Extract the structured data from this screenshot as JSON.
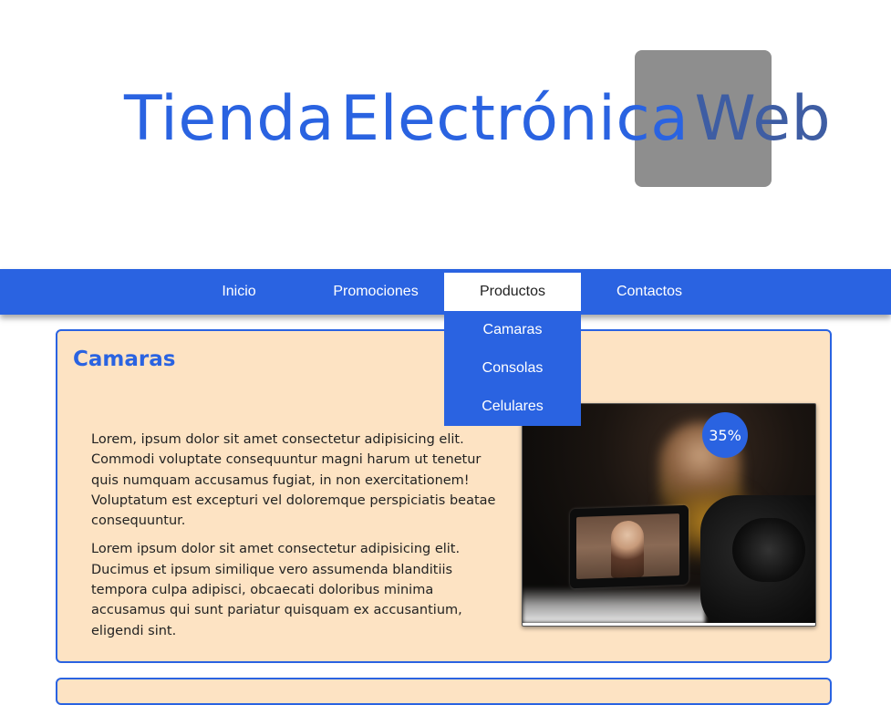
{
  "header": {
    "title_part1": "Tienda",
    "title_part2": "Electrónica",
    "title_part3": "Web"
  },
  "nav": {
    "items": [
      "Inicio",
      "Promociones",
      "Productos",
      "Contactos"
    ],
    "active": "Productos",
    "dropdown": [
      "Camaras",
      "Consolas",
      "Celulares"
    ]
  },
  "card": {
    "title": "Camaras",
    "paragraphs": [
      "Lorem, ipsum dolor sit amet consectetur adipisicing elit. Commodi voluptate consequuntur magni harum ut tenetur quis numquam accusamus fugiat, in non exercitationem! Voluptatum est excepturi vel doloremque perspiciatis beatae consequuntur.",
      "Lorem ipsum dolor sit amet consectetur adipisicing elit. Ducimus et ipsum similique vero assumenda blanditiis tempora culpa adipisci, obcaecati doloribus minima accusamus qui sunt pariatur quisquam ex accusantium, eligendi sint."
    ],
    "image_icon": "camera-photo",
    "discount_badge": "35%"
  },
  "colors": {
    "primary": "#2a63e1",
    "card_bg": "#fde3c3",
    "highlight_bg": "#8e8e8e"
  }
}
